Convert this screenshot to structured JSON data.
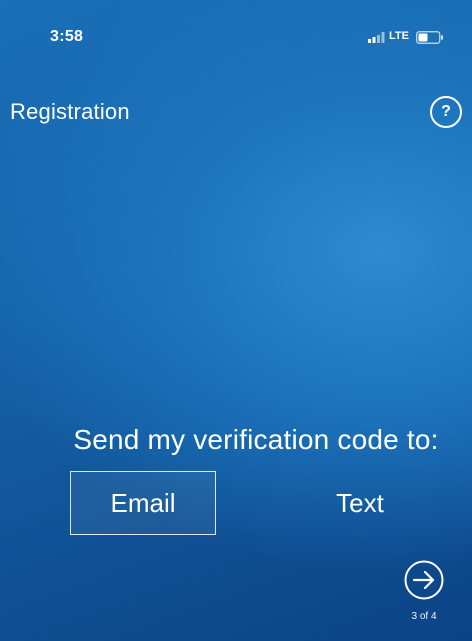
{
  "status_bar": {
    "time": "3:58",
    "network": "LTE",
    "icons": [
      "signal-bars-icon",
      "battery-icon"
    ]
  },
  "header": {
    "title": "Registration",
    "help_label": "?"
  },
  "verification": {
    "prompt": "Send my verification code to:",
    "options": [
      {
        "label": "Email",
        "selected": true
      },
      {
        "label": "Text",
        "selected": false
      }
    ]
  },
  "navigation": {
    "next_icon": "arrow-right-circle-icon",
    "step": "3 of 4"
  },
  "colors": {
    "background_top": "#1a6fb6",
    "background_bottom": "#0b4386",
    "foreground": "#ffffff"
  }
}
